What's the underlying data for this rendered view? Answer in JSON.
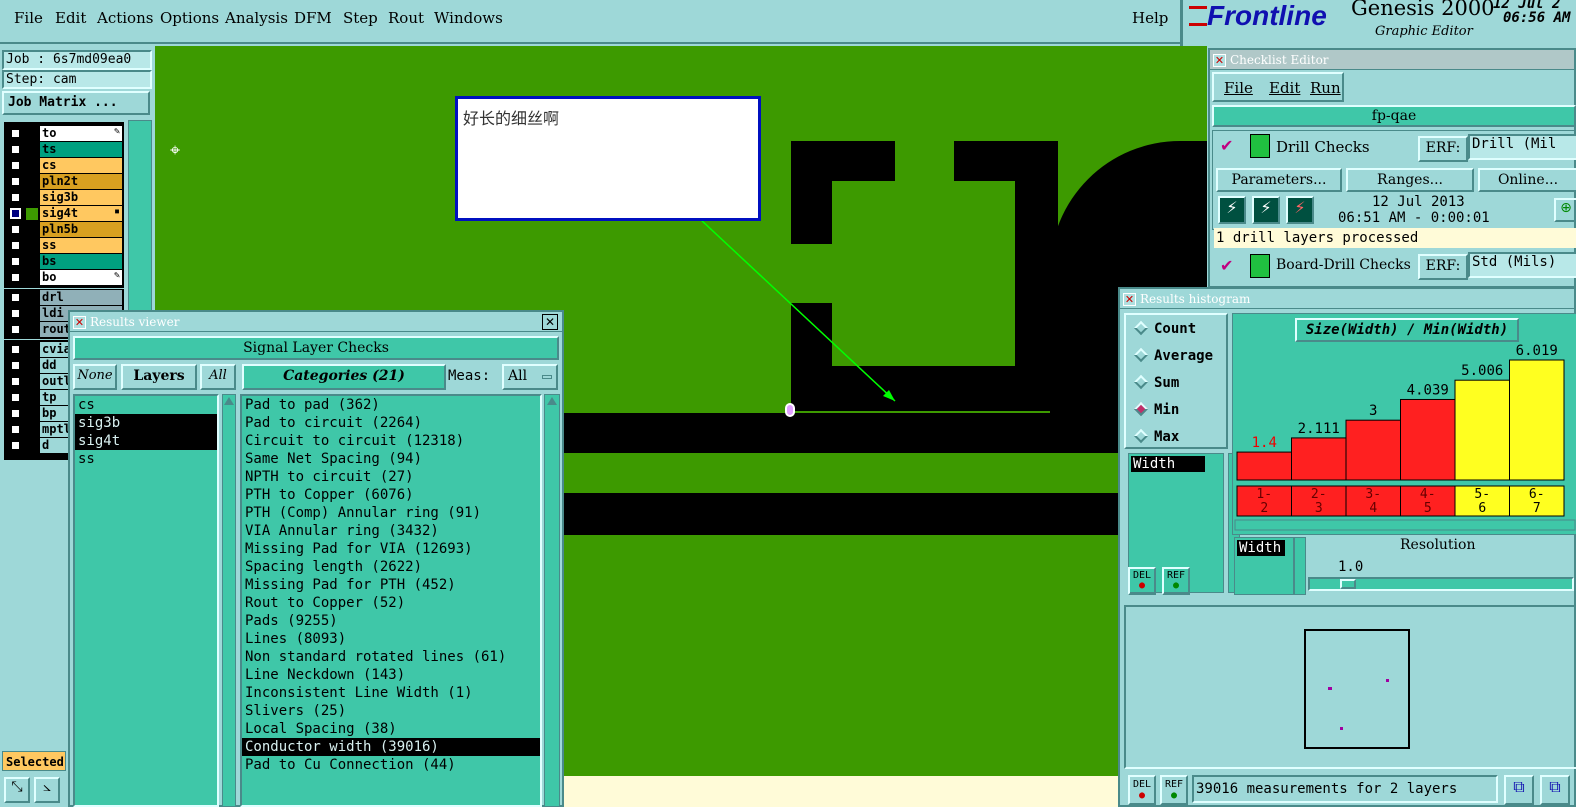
{
  "menubar": {
    "items": [
      "File",
      "Edit",
      "Actions",
      "Options",
      "Analysis",
      "DFM",
      "Step",
      "Rout",
      "Windows"
    ],
    "help": "Help"
  },
  "brand": {
    "logo": "Frontline",
    "product": "Genesis 2000",
    "subtitle": "Graphic Editor",
    "date": "12 Jul 2",
    "time": "06:56 AM"
  },
  "left": {
    "job": "Job : 6s7md09ea0",
    "step": "Step: cam",
    "job_matrix": "Job Matrix ...",
    "layers": [
      {
        "name": "to",
        "color": "#ffffff",
        "checked": false,
        "mark": "✎"
      },
      {
        "name": "ts",
        "color": "#00a080",
        "checked": false,
        "mark": ""
      },
      {
        "name": "cs",
        "color": "#ffc860",
        "checked": false,
        "mark": ""
      },
      {
        "name": "pln2t",
        "color": "#d8a020",
        "checked": false,
        "mark": ""
      },
      {
        "name": "sig3b",
        "color": "#ffc860",
        "checked": false,
        "mark": ""
      },
      {
        "name": "sig4t",
        "color": "#ffc860",
        "checked": true,
        "mark": "▪"
      },
      {
        "name": "pln5b",
        "color": "#d8a020",
        "checked": false,
        "mark": ""
      },
      {
        "name": "ss",
        "color": "#ffc860",
        "checked": false,
        "mark": ""
      },
      {
        "name": "bs",
        "color": "#00a080",
        "checked": false,
        "mark": ""
      },
      {
        "name": "bo",
        "color": "#ffffff",
        "checked": false,
        "mark": "✎"
      }
    ],
    "layers2": [
      {
        "name": "drl",
        "color": "#90b0b8"
      },
      {
        "name": "ldi",
        "color": "#90b0b8"
      },
      {
        "name": "rout",
        "color": "#90b0b8"
      }
    ],
    "layers3": [
      {
        "name": "cvia",
        "color": "#9ed8d8"
      },
      {
        "name": "dd",
        "color": "#9ed8d8"
      },
      {
        "name": "outl",
        "color": "#9ed8d8"
      },
      {
        "name": "tp",
        "color": "#9ed8d8"
      },
      {
        "name": "bp",
        "color": "#9ed8d8"
      },
      {
        "name": "mptl",
        "color": "#9ed8d8"
      },
      {
        "name": "d",
        "color": "#9ed8d8"
      }
    ],
    "selected": "Selected"
  },
  "canvas": {
    "note": "好长的细丝啊"
  },
  "results_viewer": {
    "title": "Results viewer",
    "header": "Signal Layer Checks",
    "none": "None",
    "layers_btn": "Layers",
    "all": "All",
    "categories_btn": "Categories (21)",
    "meas_label": "Meas:",
    "meas_value": "All",
    "layer_list": [
      {
        "t": "cs",
        "sel": false
      },
      {
        "t": "sig3b",
        "sel": true
      },
      {
        "t": "sig4t",
        "sel": true
      },
      {
        "t": "ss",
        "sel": false
      }
    ],
    "categories": [
      {
        "t": "Pad to pad (362)",
        "sel": false
      },
      {
        "t": "Pad to circuit (2264)",
        "sel": false
      },
      {
        "t": "Circuit to circuit (12318)",
        "sel": false
      },
      {
        "t": "Same Net Spacing (94)",
        "sel": false
      },
      {
        "t": "NPTH to circuit (27)",
        "sel": false
      },
      {
        "t": "PTH to Copper (6076)",
        "sel": false
      },
      {
        "t": "PTH (Comp) Annular ring (91)",
        "sel": false
      },
      {
        "t": "VIA Annular ring (3432)",
        "sel": false
      },
      {
        "t": "Missing Pad for VIA (12693)",
        "sel": false
      },
      {
        "t": "Spacing length (2622)",
        "sel": false
      },
      {
        "t": "Missing Pad for PTH (452)",
        "sel": false
      },
      {
        "t": "Rout to Copper (52)",
        "sel": false
      },
      {
        "t": "Pads (9255)",
        "sel": false
      },
      {
        "t": "Lines (8093)",
        "sel": false
      },
      {
        "t": "Non standard rotated lines (61)",
        "sel": false
      },
      {
        "t": "Line Neckdown (143)",
        "sel": false
      },
      {
        "t": "Inconsistent Line Width (1)",
        "sel": false
      },
      {
        "t": "Slivers (25)",
        "sel": false
      },
      {
        "t": "Local Spacing (38)",
        "sel": false
      },
      {
        "t": "Conductor width (39016)",
        "sel": true
      },
      {
        "t": "Pad to Cu Connection (44)",
        "sel": false
      }
    ]
  },
  "checklist": {
    "title": "Checklist Editor",
    "menu": [
      "File",
      "Edit",
      "Run"
    ],
    "name": "fp-qae",
    "check1": "Drill Checks",
    "erf": "ERF:",
    "erf_val1": "Drill (Mil",
    "params": "Parameters...",
    "ranges": "Ranges...",
    "online": "Online...",
    "date": "12 Jul 2013",
    "time": "06:51 AM - 0:00:01",
    "status": "1 drill layers processed",
    "check2": "Board-Drill Checks",
    "erf_val2": "Std (Mils)"
  },
  "histogram": {
    "title": "Results histogram",
    "modes": [
      "Count",
      "Average",
      "Sum",
      "Min",
      "Max"
    ],
    "mode_selected": "Min",
    "chart_title": "Size(Width) / Min(Width)",
    "field": "Width",
    "field2": "Width",
    "del": "DEL",
    "ref": "REF",
    "resolution_label": "Resolution",
    "resolution_value": "1.0",
    "status": "39016 measurements for 2 layers"
  },
  "chart_data": {
    "type": "bar",
    "title": "Size(Width) / Min(Width)",
    "categories": [
      "1-2",
      "2-3",
      "3-4",
      "4-5",
      "5-6",
      "6-7"
    ],
    "values": [
      1.4,
      2.111,
      3,
      4.039,
      5.006,
      6.019
    ],
    "labels": [
      "1.4",
      "2.111",
      "3",
      "4.039",
      "5.006",
      "6.019"
    ],
    "colors": [
      "#ff2020",
      "#ff2020",
      "#ff2020",
      "#ff2020",
      "#ffff20",
      "#ffff20"
    ],
    "ylim": [
      0,
      6.019
    ]
  }
}
